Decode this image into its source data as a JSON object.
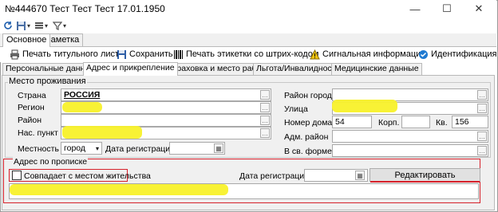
{
  "window": {
    "title": "№444670 Тест Тест Тест 17.01.1950",
    "minimize": "—",
    "maximize": "☐",
    "close": "✕"
  },
  "qat": {
    "refresh_icon": "refresh-icon",
    "save_icon": "save-icon",
    "filter_icon": "filter-icon"
  },
  "ribbon_tabs": [
    {
      "label": "Основное"
    },
    {
      "label": "Заметка"
    }
  ],
  "toolbar": {
    "print_title": "Печать титульного листа",
    "save": "Сохранить",
    "print_labels": "Печать этикетки со штрих-кодом",
    "signal_info": "Сигнальная информация",
    "identification": "Идентификация"
  },
  "sub_tabs": [
    {
      "label": "Персональные данные"
    },
    {
      "label": "Адрес и прикрепление"
    },
    {
      "label": "Страховка и место работы"
    },
    {
      "label": "Льгота/Инвалидность"
    },
    {
      "label": "Медицинские данные"
    }
  ],
  "residence": {
    "group_label": "Место проживания",
    "country_label": "Страна",
    "country_value": "РОССИЯ",
    "region_label": "Регион",
    "region_value": "",
    "district_label": "Район",
    "district_value": "",
    "locality_label": "Нас. пункт",
    "locality_value": "",
    "area_label": "Местность",
    "area_value": "город",
    "reg_date_label": "Дата регистрации",
    "reg_date_value": "",
    "city_district_label": "Район города",
    "city_district_value": "",
    "street_label": "Улица",
    "street_value": "",
    "house_label": "Номер дома",
    "house_value": "54",
    "building_label": "Корп.",
    "building_value": "",
    "apt_label": "Кв.",
    "apt_value": "156",
    "adm_district_label": "Адм. район",
    "adm_district_value": "",
    "military_label": "В св. форме",
    "military_value": ""
  },
  "registration": {
    "group_label": "Адрес по прописке",
    "same_as_residence": "Совпадает с местом жительства",
    "reg_date_label": "Дата регистрации",
    "reg_date_value": "",
    "edit_button": "Редактировать"
  },
  "colors": {
    "highlight": "#f8f12a",
    "red_frame": "#d6212b",
    "accent": "#1f5fae"
  }
}
